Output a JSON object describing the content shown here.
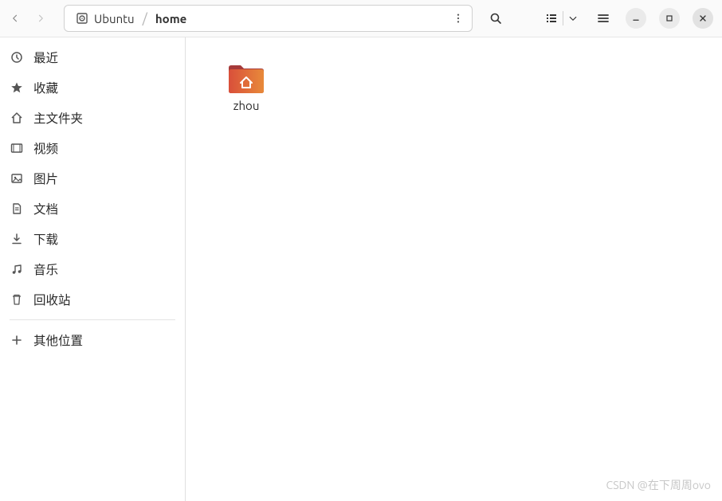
{
  "header": {
    "path": {
      "root_label": "Ubuntu",
      "current": "home"
    }
  },
  "sidebar": {
    "items": [
      {
        "id": "recent",
        "label": "最近",
        "icon": "clock-icon"
      },
      {
        "id": "starred",
        "label": "收藏",
        "icon": "star-icon"
      },
      {
        "id": "home",
        "label": "主文件夹",
        "icon": "home-icon"
      },
      {
        "id": "videos",
        "label": "视频",
        "icon": "video-icon"
      },
      {
        "id": "pictures",
        "label": "图片",
        "icon": "picture-icon"
      },
      {
        "id": "documents",
        "label": "文档",
        "icon": "document-icon"
      },
      {
        "id": "downloads",
        "label": "下载",
        "icon": "download-icon"
      },
      {
        "id": "music",
        "label": "音乐",
        "icon": "music-icon"
      },
      {
        "id": "trash",
        "label": "回收站",
        "icon": "trash-icon"
      }
    ],
    "other_locations_label": "其他位置"
  },
  "content": {
    "files": [
      {
        "name": "zhou",
        "type": "home-folder"
      }
    ]
  },
  "watermark": "CSDN @在下周周ovo"
}
